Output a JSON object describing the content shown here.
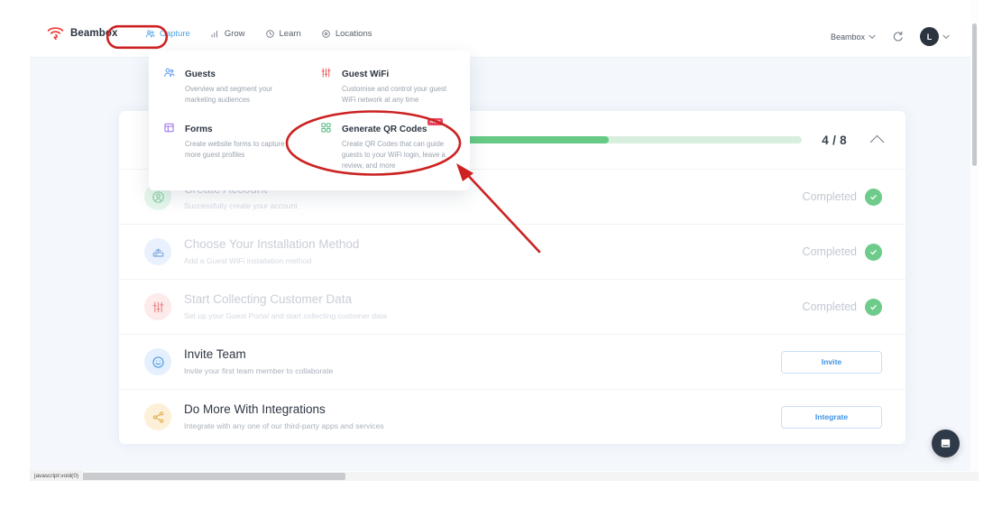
{
  "brand": {
    "name": "Beambox",
    "logo_icon": "wifi-signal-icon"
  },
  "nav": {
    "items": [
      {
        "label": "Capture",
        "icon": "people-icon",
        "active": true
      },
      {
        "label": "Grow",
        "icon": "bar-chart-icon",
        "active": false
      },
      {
        "label": "Learn",
        "icon": "clock-icon",
        "active": false
      },
      {
        "label": "Locations",
        "icon": "pin-icon",
        "active": false
      }
    ],
    "org_selector": "Beambox",
    "refresh_icon": "refresh-icon",
    "avatar_initial": "L",
    "chevron_icon": "chevron-down-icon"
  },
  "menu": {
    "items": [
      {
        "title": "Guests",
        "desc": "Overview and segment your marketing audiences",
        "icon": "guests-people-icon",
        "badge": ""
      },
      {
        "title": "Guest WiFi",
        "desc": "Customise and control your guest WiFi network at any time",
        "icon": "sliders-icon",
        "badge": ""
      },
      {
        "title": "Forms",
        "desc": "Create website forms to capture more guest profiles",
        "icon": "form-layout-icon",
        "badge": ""
      },
      {
        "title": "Generate QR Codes",
        "desc": "Create QR Codes that can guide guests to your WiFi login, leave a review, and more",
        "icon": "qr-code-icon",
        "badge": "NEW"
      }
    ]
  },
  "progress": {
    "completed": 4,
    "total": 8,
    "count_label": "4 / 8",
    "percent": 50,
    "collapse_icon": "chevron-up-icon",
    "fill_color": "#66ca85",
    "track_color": "#d7efdc"
  },
  "tasks": [
    {
      "title": "Create Account",
      "desc": "Successfully create your account",
      "icon": "user-circle-icon",
      "icon_bg": "#e6f7ec",
      "icon_color": "#8fd3a8",
      "status": "Completed",
      "action": "",
      "faded": true
    },
    {
      "title": "Choose Your Installation Method",
      "desc": "Add a Guest WiFi installation method",
      "icon": "router-icon",
      "icon_bg": "#e8f1fd",
      "icon_color": "#7fa9dd",
      "status": "Completed",
      "action": "",
      "faded": true
    },
    {
      "title": "Start Collecting Customer Data",
      "desc": "Set up your Guest Portal and start collecting customer data",
      "icon": "sliders-icon",
      "icon_bg": "#fdeaea",
      "icon_color": "#e88b8b",
      "status": "Completed",
      "action": "",
      "faded": true
    },
    {
      "title": "Invite Team",
      "desc": "Invite your first team member to collaborate",
      "icon": "smiley-icon",
      "icon_bg": "#e4f0fd",
      "icon_color": "#4f9de0",
      "status": "",
      "action": "Invite",
      "faded": false
    },
    {
      "title": "Do More With Integrations",
      "desc": "Integrate with any one of our third-party apps and services",
      "icon": "share-nodes-icon",
      "icon_bg": "#fdf0d9",
      "icon_color": "#e2ac53",
      "status": "",
      "action": "Integrate",
      "faded": false
    }
  ],
  "annotations": {
    "highlight_color": "#cc2222",
    "ring_capture": "capture-nav-highlight",
    "ring_qr": "generate-qr-codes-highlight",
    "arrow": "pointer-arrow"
  },
  "chat": {
    "icon": "chat-bubble-icon"
  },
  "browser": {
    "status_text": "javascript:void(0)"
  }
}
